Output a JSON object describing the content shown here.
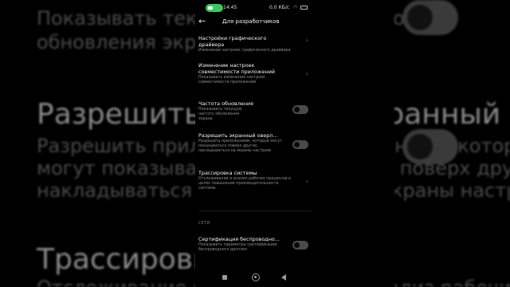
{
  "background": {
    "top_sub_1": "Показывать текущую",
    "top_sub_2": "обновления экрана",
    "title_overlay": "Разрешить экранный оверл...",
    "overlay_sub_1": "Разрешить приложениям, которые",
    "overlay_sub_2": "могут показываться поверх других,",
    "overlay_sub_3": "накладываться на экраны настроек",
    "title_trace": "Трассировка системы",
    "trace_sub": "Отслеживание и анализ рабочих процессов"
  },
  "status_bar": {
    "time": "14:45",
    "speed": "0,0 КБ/с"
  },
  "header": {
    "title": "Для разработчиков"
  },
  "items": [
    {
      "title": "Настройки графического драйвера",
      "subtitle": "Изменение настроек графического драйвера",
      "control": "chevron"
    },
    {
      "title": "Изменение настроек совместимости приложений",
      "subtitle": "Показывать изменение настроек совместимости приложений",
      "control": "chevron"
    },
    {
      "title": "Частота обновления",
      "subtitle": "Показывать текущую частоту обновления экрана",
      "control": "toggle",
      "enabled": false
    },
    {
      "title": "Разрешить экранный оверл...",
      "subtitle": "Разрешить приложениям, которые могут показываться поверх других, накладываться на экраны настроек",
      "control": "toggle",
      "enabled": false
    },
    {
      "title": "Трассировка системы",
      "subtitle": "Отслеживание и анализ рабочих процессов в целях повышения производительности системы",
      "control": "chevron"
    },
    {
      "title": "Сертификация беспроводно...",
      "subtitle": "Показывать параметры сертификации беспроводного дисплея",
      "control": "toggle",
      "enabled": false
    }
  ],
  "section_network": "СЕТИ",
  "colors": {
    "accent_green": "#38c95a",
    "toggle_off": "#4a4a4a"
  }
}
